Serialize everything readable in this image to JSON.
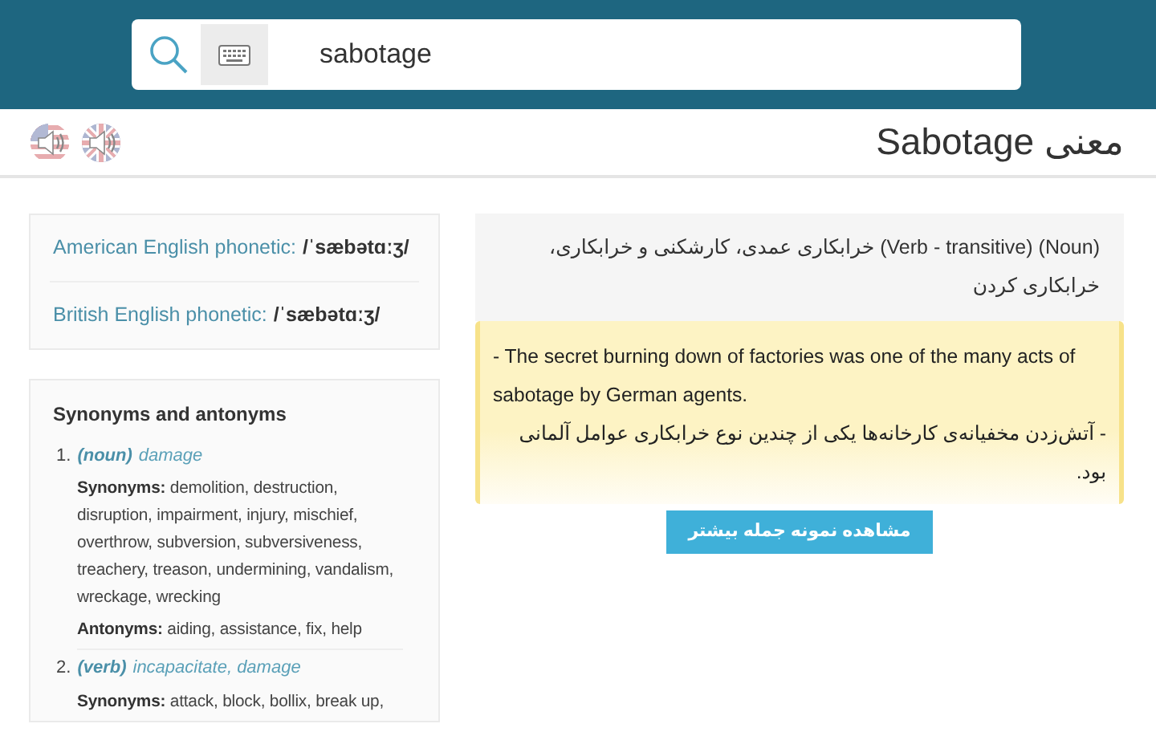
{
  "search": {
    "value": "sabotage"
  },
  "title": "معنی Sabotage",
  "pronunciations": [
    {
      "kind": "us"
    },
    {
      "kind": "uk"
    }
  ],
  "phonetics": [
    {
      "label": "American English phonetic:",
      "value": "/ˈsæbətɑːʒ/"
    },
    {
      "label": "British English phonetic:",
      "value": "/ˈsæbətɑːʒ/"
    }
  ],
  "synonyms": {
    "heading": "Synonyms and antonyms",
    "senses": [
      {
        "number": "1.",
        "pos": "(noun)",
        "words": "damage",
        "groups": [
          {
            "label": "Synonyms:",
            "text": "demolition, destruction, disruption, impairment, injury, mischief, overthrow, subversion, subversiveness, treachery, treason, undermining, vandalism, wreckage, wrecking"
          },
          {
            "label": "Antonyms:",
            "text": "aiding, assistance, fix, help"
          }
        ]
      },
      {
        "number": "2.",
        "pos": "(verb)",
        "words": "incapacitate, damage",
        "groups": [
          {
            "label": "Synonyms:",
            "text": "attack, block, bollix, break up,"
          }
        ]
      }
    ]
  },
  "meaning": {
    "tags": [
      "(Verb - transitive)",
      "(Noun)"
    ],
    "text": "خرابکاری عمدی، کارشکنی و خرابکاری، خرابکاری کردن"
  },
  "example": {
    "english": "- The secret burning down of factories was one of the many acts of sabotage by German agents.",
    "persian": "- آتش‌زدن مخفیانه‌ی کارخانه‌ها یکی از چندین نوع خرابکاری عوامل آلمانی بود."
  },
  "more_button": "مشاهده نمونه جمله بیشتر"
}
